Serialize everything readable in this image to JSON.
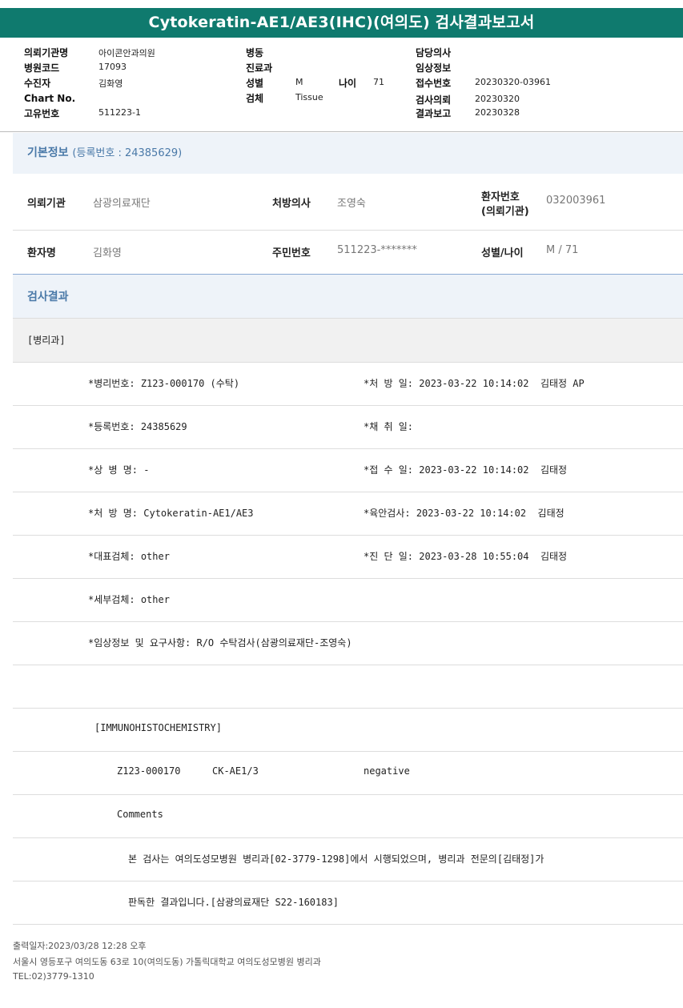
{
  "title": "Cytokeratin-AE1/AE3(IHC)(여의도) 검사결과보고서",
  "header": {
    "institution_label": "의뢰기관명",
    "institution_value": "아이콘안과의원",
    "hospital_code_label": "병원코드",
    "hospital_code_value": "17093",
    "patient_label": "수진자",
    "patient_value": "김화영",
    "chart_no_label": "Chart No.",
    "chart_no_value": "",
    "unique_no_label": "고유번호",
    "unique_no_value": "511223-1",
    "ward_label": "병동",
    "ward_value": "",
    "dept_label": "진료과",
    "dept_value": "",
    "sex_label": "성별",
    "sex_value": "M",
    "age_label": "나이",
    "age_value": "71",
    "specimen_label": "검체",
    "specimen_value": "Tissue",
    "doctor_label": "담당의사",
    "doctor_value": "",
    "clinical_label": "임상정보",
    "clinical_value": "",
    "receipt_label": "접수번호",
    "receipt_value": "20230320-03961",
    "request_label": "검사의뢰",
    "request_value": "20230320",
    "report_label": "결과보고",
    "report_value": "20230328"
  },
  "basic_info": {
    "title": "기본정보",
    "subtitle": "(등록번호 : 24385629)",
    "rows": [
      {
        "c1_label": "의뢰기관",
        "c1_value": "삼광의료재단",
        "c2_label": "처방의사",
        "c2_value": "조영숙",
        "c3_label_line1": "환자번호",
        "c3_label_line2": "(의뢰기관)",
        "c3_value": "032003961"
      },
      {
        "c1_label": "환자명",
        "c1_value": "김화영",
        "c2_label": "주민번호",
        "c2_value": "511223-*******",
        "c3_label": "성별/나이",
        "c3_value": "M / 71"
      }
    ]
  },
  "results": {
    "title": "검사결과",
    "dept_header": "[병리과]",
    "rows": [
      {
        "left": "*병리번호: Z123-000170 (수탁)",
        "right": "*처 방 일: 2023-03-22 10:14:02  김태정 AP"
      },
      {
        "left": "*등록번호: 24385629",
        "right": "*채 취 일:"
      },
      {
        "left": "*상 병 명: -",
        "right": "*접 수 일: 2023-03-22 10:14:02  김태정"
      },
      {
        "left": "*처 방 명: Cytokeratin-AE1/AE3",
        "right": "*육안검사: 2023-03-22 10:14:02  김태정"
      },
      {
        "left": "*대표검체: other",
        "right": "*진 단 일: 2023-03-28 10:55:04  김태정"
      },
      {
        "left": "*세부검체: other",
        "right": ""
      },
      {
        "left": "*임상정보 및 요구사항: R/O 수탁검사(삼광의료재단-조영숙)",
        "right": ""
      }
    ],
    "ihc_header": "[IMMUNOHISTOCHEMISTRY]",
    "ihc_row": {
      "id": "Z123-000170",
      "marker": "CK-AE1/3",
      "result": "negative"
    },
    "comments_label": "Comments",
    "comment_line1": "본 검사는 여의도성모병원 병리과[02-3779-1298]에서 시행되었으며, 병리과 전문의[김태정]가",
    "comment_line2": "판독한 결과입니다.[삼광의료재단 S22-160183]"
  },
  "footer": {
    "printed": "출력일자:2023/03/28 12:28 오후",
    "address": "서울시 영등포구 여의도동 63로 10(여의도동) 가톨릭대학교 여의도성모병원 병리과",
    "tel": "TEL:02)3779-1310"
  },
  "colors": {
    "title_bar": "#0f7a6e",
    "section_title": "#4a79a8",
    "section_bar": "#eef3f9"
  }
}
